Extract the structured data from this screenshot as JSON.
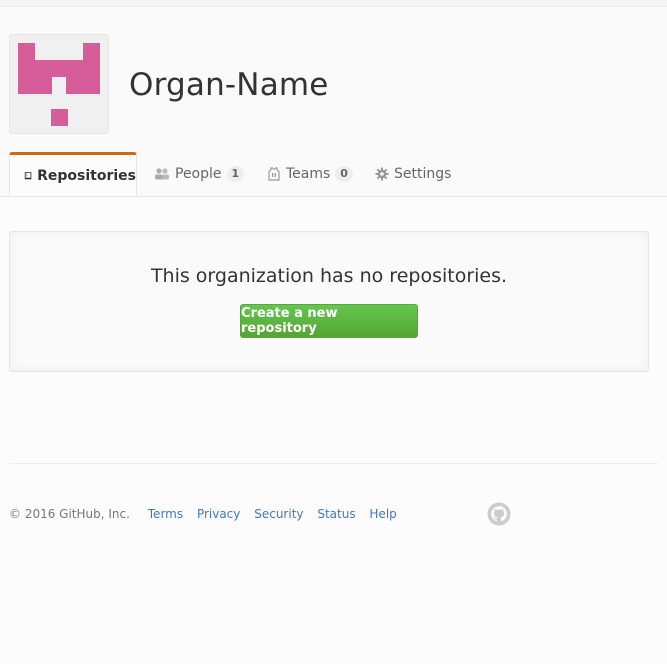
{
  "org": {
    "name": "Organ-Name"
  },
  "tabs": [
    {
      "label": "Repositories",
      "icon": "repo-icon",
      "selected": true
    },
    {
      "label": "People",
      "icon": "people-icon",
      "count": "1"
    },
    {
      "label": "Teams",
      "icon": "jersey-icon",
      "count": "0"
    },
    {
      "label": "Settings",
      "icon": "gear-icon"
    }
  ],
  "blankslate": {
    "message": "This organization has no repositories.",
    "button": "Create a new repository"
  },
  "footer": {
    "copyright": "© 2016 GitHub, Inc.",
    "links": [
      "Terms",
      "Privacy",
      "Security",
      "Status",
      "Help"
    ]
  },
  "colors": {
    "avatar": "#d65c9a",
    "accent_tab": "#d26911",
    "button_green": "#55a532",
    "link": "#4078c0"
  }
}
